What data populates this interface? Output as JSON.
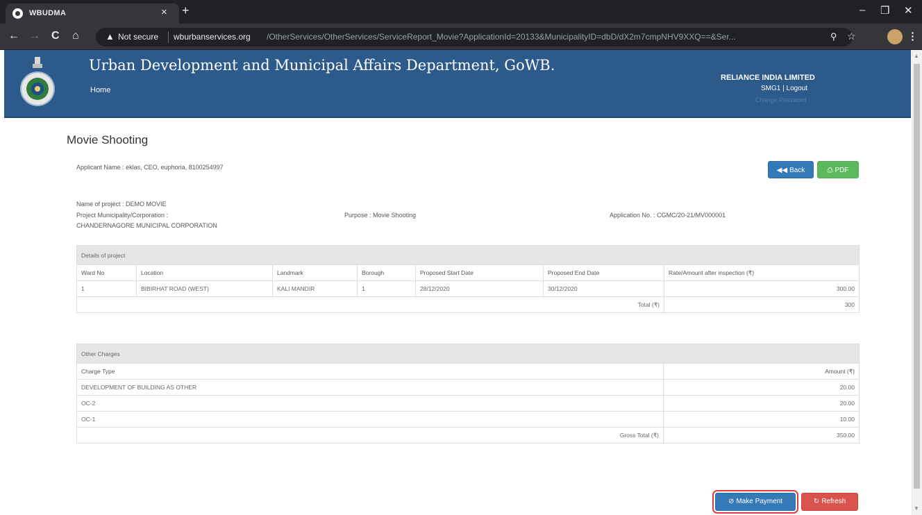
{
  "browser": {
    "tab_title": "WBUDMA",
    "tab_close": "×",
    "new_tab": "+",
    "win_min": "–",
    "win_max": "❐",
    "win_close": "✕",
    "back": "←",
    "forward": "→",
    "reload": "C",
    "home": "⌂",
    "not_secure": "Not secure",
    "url_host": "wburbanservices.org",
    "url_path": "/OtherServices/OtherServices/ServiceReport_Movie?ApplicationId=20133&MunicipalityID=dbD/dX2m7cmpNHV9XXQ==&Ser...",
    "menu": "⋮"
  },
  "header": {
    "title": "Urban Development and Municipal Affairs Department, GoWB.",
    "home_link": "Home",
    "org_name": "RELIANCE INDIA LIMITED",
    "user": "SMG1",
    "separator": "|",
    "logout": "Logout",
    "change_password": "Change Password",
    "bg_color": "#2b5a8b"
  },
  "page": {
    "title": "Movie Shooting",
    "applicant_label": "Applicant Name :",
    "applicant_value": "eklas, CEO, euphoria, 8100254997",
    "back_button": "Back",
    "pdf_button": "PDF",
    "project_name_label": "Name of project :",
    "project_name_value": "DEMO MOVIE",
    "municipality_label": "Project Municipality/Corporation :",
    "municipality_value": "CHANDERNAGORE MUNICIPAL CORPORATION",
    "purpose_label": "Purpose :",
    "purpose_value": "Movie Shooting",
    "application_no_label": "Application No. :",
    "application_no_value": "CGMC/20-21/MV000001"
  },
  "project_table": {
    "title": "Details of project",
    "headers": [
      "Ward No",
      "Location",
      "Landmark",
      "Borough",
      "Proposed Start Date",
      "Proposed End Date",
      "Rate/Amount after inspection (₹)"
    ],
    "rows": [
      [
        "1",
        "BIBIRHAT ROAD (WEST)",
        "KALI MANDIR",
        "1",
        "28/12/2020",
        "30/12/2020",
        "300.00"
      ]
    ],
    "total_label": "Total (₹)",
    "total_value": "300"
  },
  "charges_table": {
    "title": "Other Charges",
    "headers": [
      "Charge Type",
      "Amount (₹)"
    ],
    "rows": [
      [
        "DEVELOPMENT OF BUILDING AS OTHER",
        "20.00"
      ],
      [
        "OC-2",
        "20.00"
      ],
      [
        "OC-1",
        "10.00"
      ]
    ],
    "gross_total_label": "Gross Total (₹)",
    "gross_total_value": "350.00"
  },
  "actions": {
    "make_payment": "Make Payment",
    "refresh": "Refresh",
    "primary_color": "#337ab7",
    "danger_color": "#d9534f",
    "highlight_color": "#e03c3c"
  }
}
